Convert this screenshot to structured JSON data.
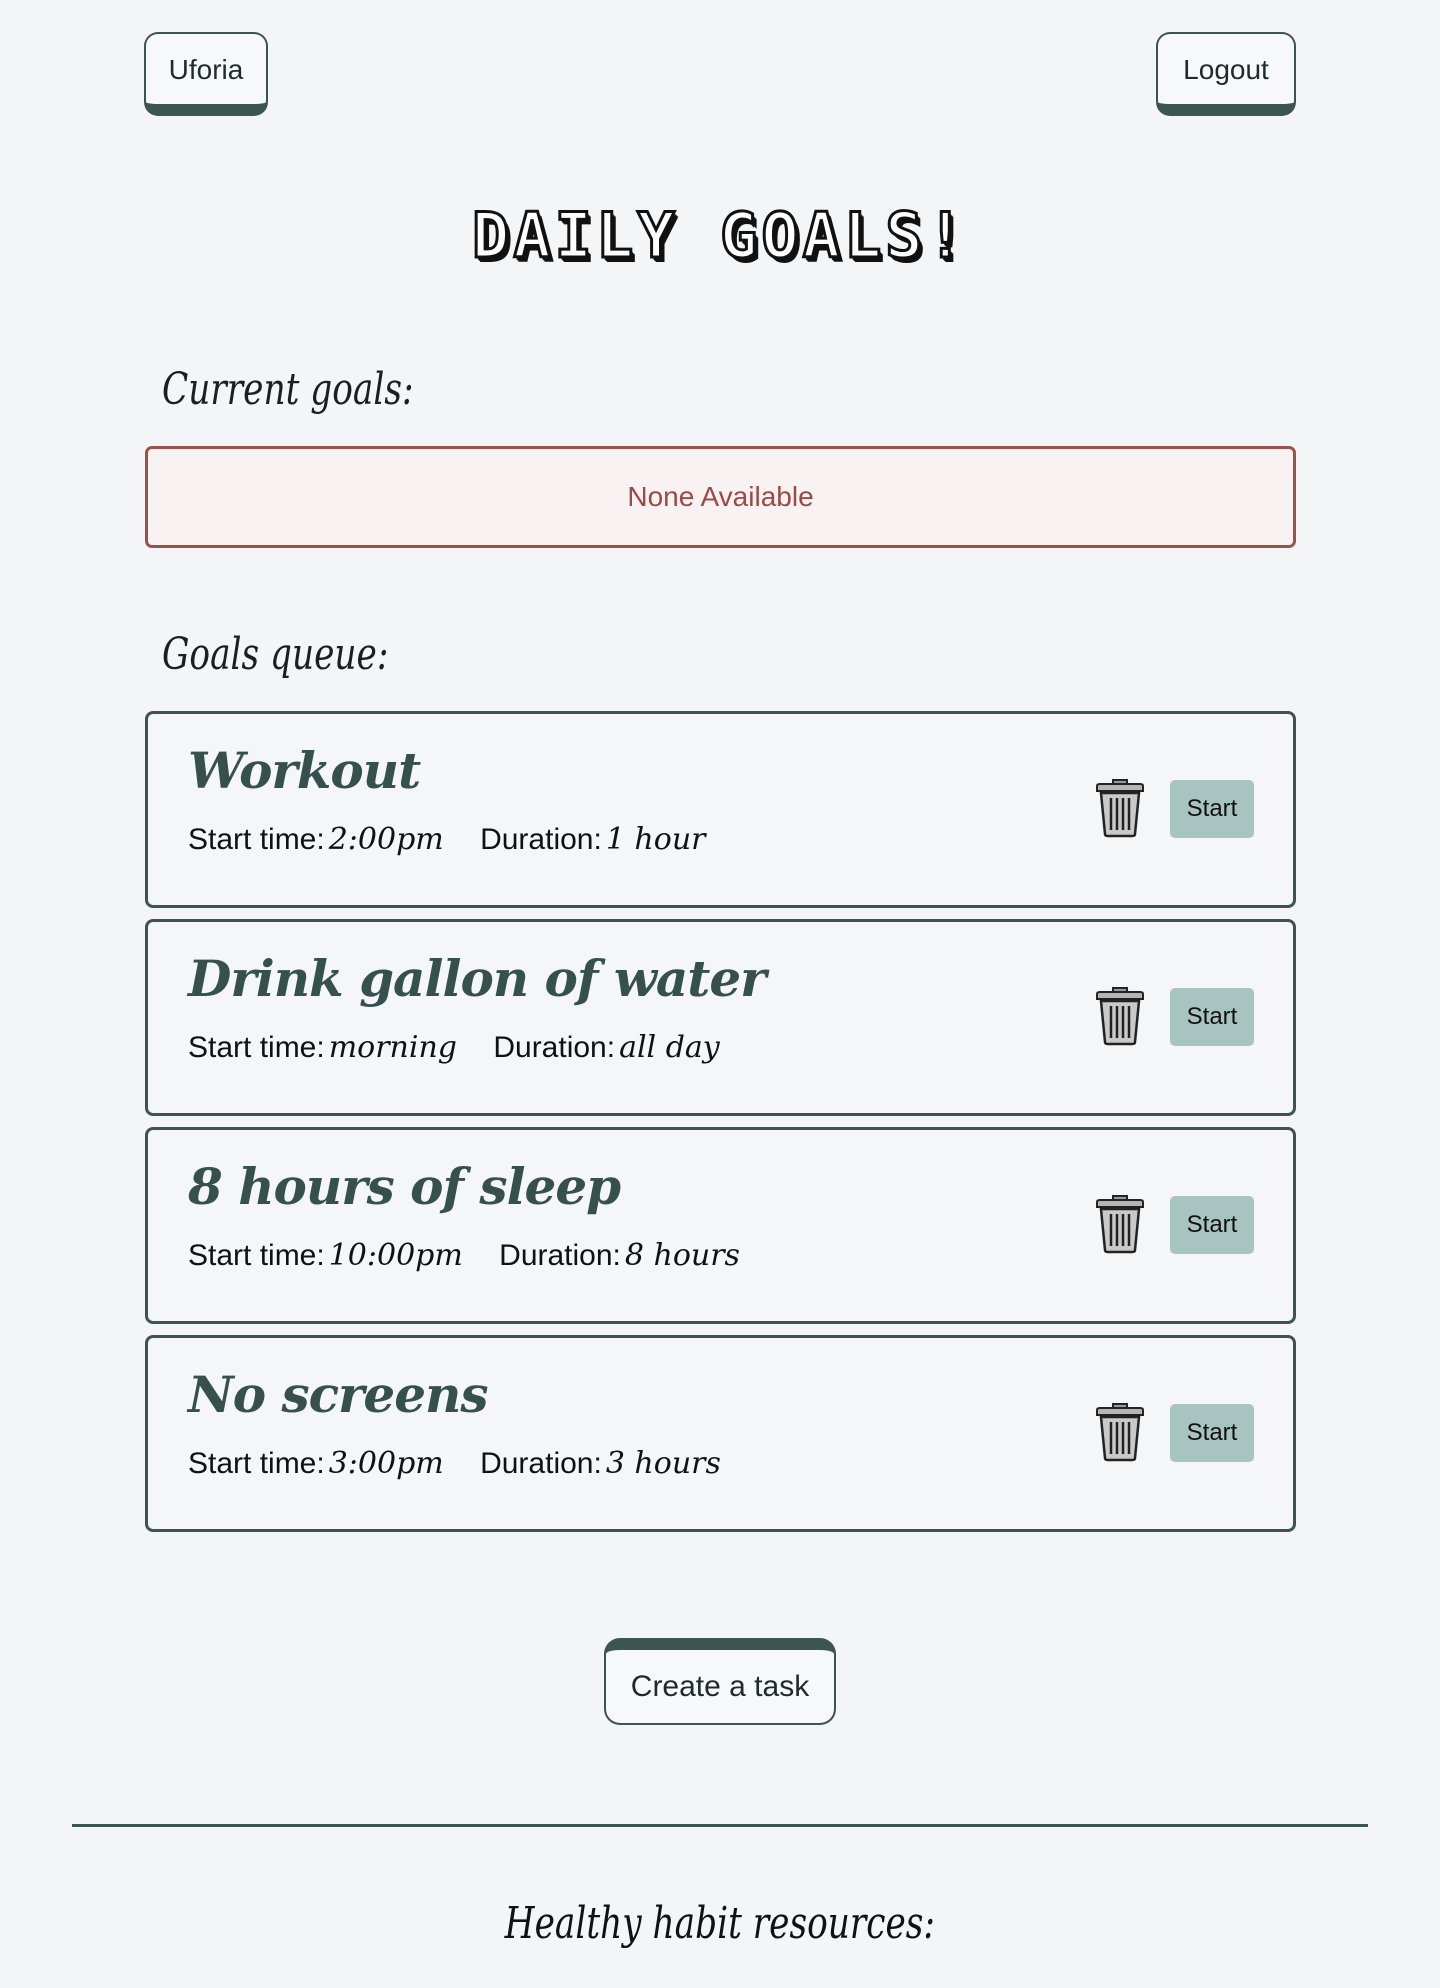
{
  "header": {
    "brand_label": "Uforia",
    "logout_label": "Logout"
  },
  "page_title": "DAILY GOALS!",
  "current_goals": {
    "label": "Current goals:",
    "empty_text": "None Available"
  },
  "goals_queue": {
    "label": "Goals queue:",
    "start_time_label": "Start time:",
    "duration_label": "Duration:",
    "start_button_label": "Start",
    "items": [
      {
        "title": "Workout",
        "start_time": "2:00pm",
        "duration": "1 hour"
      },
      {
        "title": "Drink gallon of water",
        "start_time": "morning",
        "duration": "all day"
      },
      {
        "title": "8 hours of sleep",
        "start_time": "10:00pm",
        "duration": "8 hours"
      },
      {
        "title": "No screens",
        "start_time": "3:00pm",
        "duration": "3 hours"
      }
    ]
  },
  "create_task_label": "Create a task",
  "resources_label": "Healthy habit resources:",
  "icons": {
    "delete": "trash-icon"
  },
  "colors": {
    "accent": "#3c5553",
    "start_button": "#a8c4c0",
    "empty_border": "#a0504a",
    "title_text": "#35504d"
  }
}
